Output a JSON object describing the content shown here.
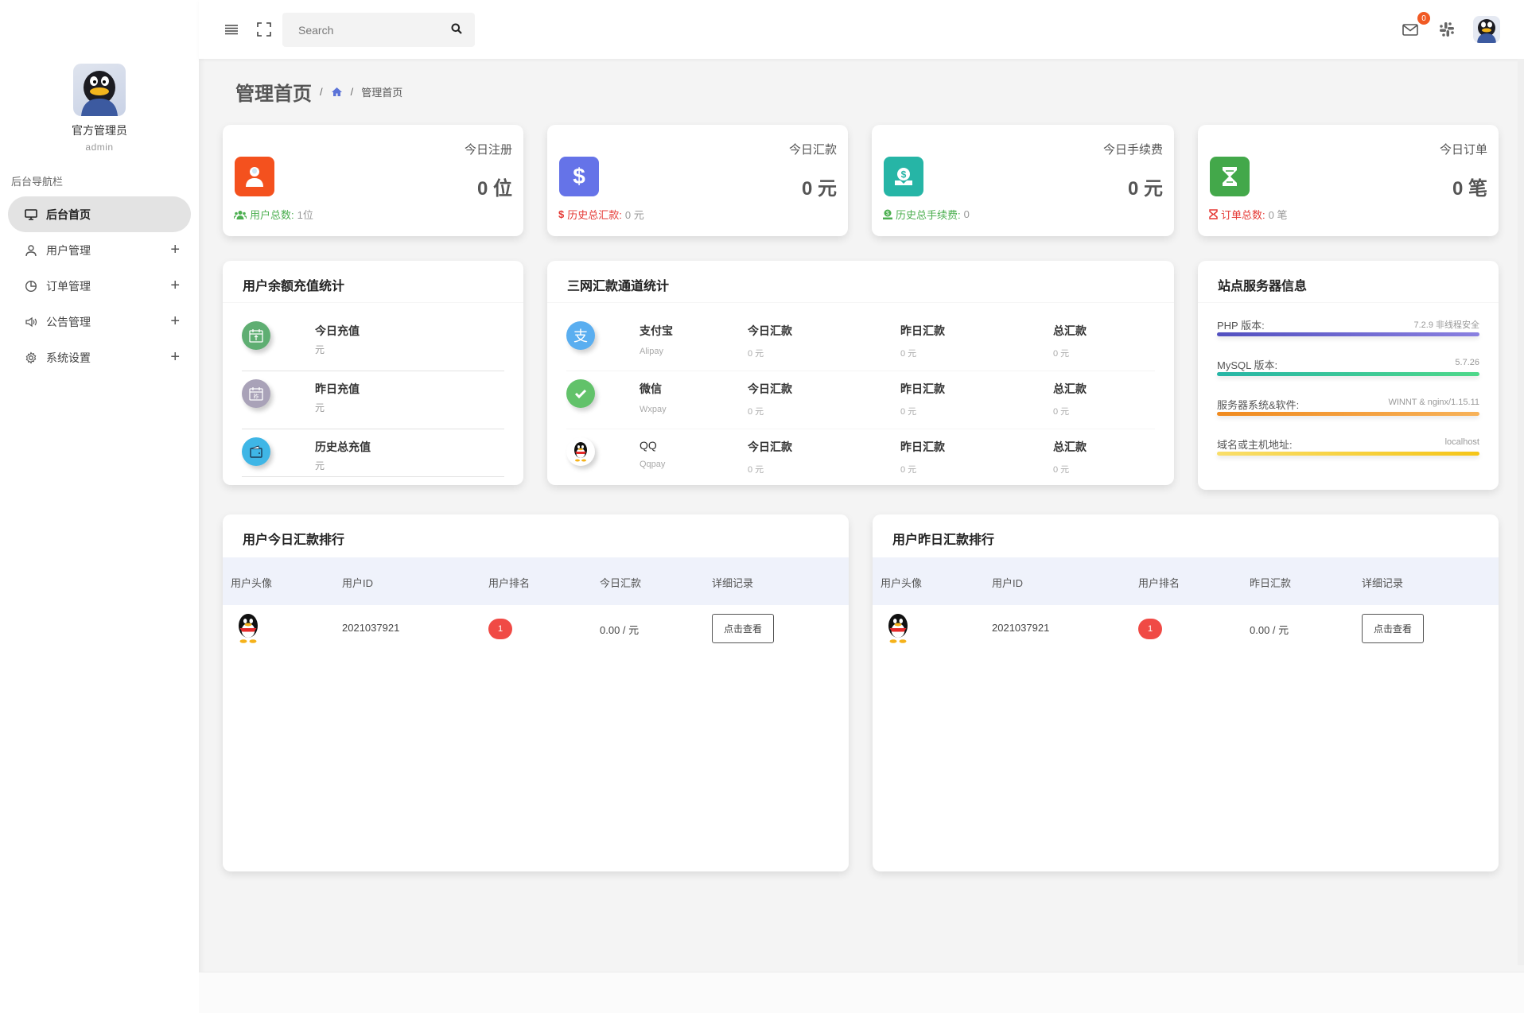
{
  "sidebar": {
    "profile": {
      "name": "官方管理员",
      "role": "admin"
    },
    "nav_title": "后台导航栏",
    "items": [
      {
        "label": "后台首页",
        "icon": "monitor-icon",
        "active": true,
        "expandable": false
      },
      {
        "label": "用户管理",
        "icon": "user-icon",
        "active": false,
        "expandable": true
      },
      {
        "label": "订单管理",
        "icon": "pie-chart-icon",
        "active": false,
        "expandable": true
      },
      {
        "label": "公告管理",
        "icon": "speaker-icon",
        "active": false,
        "expandable": true
      },
      {
        "label": "系统设置",
        "icon": "gear-icon",
        "active": false,
        "expandable": true
      }
    ],
    "expand_glyph": "+"
  },
  "topbar": {
    "search_placeholder": "Search",
    "mail_badge": "0"
  },
  "page": {
    "title": "管理首页",
    "breadcrumb": {
      "separator": "/",
      "current": "管理首页"
    }
  },
  "stats": [
    {
      "label": "今日注册",
      "value": "0 位",
      "foot_label": "用户总数:",
      "foot_value": "1位",
      "color": "#f4511e",
      "foot_color": "#4caf50",
      "icon": "user-icon"
    },
    {
      "label": "今日汇款",
      "value": "0 元",
      "foot_label": "历史总汇款:",
      "foot_value": "0 元",
      "color": "#6573e8",
      "foot_color": "#e53935",
      "icon": "dollar-icon"
    },
    {
      "label": "今日手续费",
      "value": "0 元",
      "foot_label": "历史总手续费:",
      "foot_value": "0",
      "color": "#26b5a6",
      "foot_color": "#4caf50",
      "icon": "money-bag-icon"
    },
    {
      "label": "今日订单",
      "value": "0 笔",
      "foot_label": "订单总数:",
      "foot_value": "0 笔",
      "color": "#43a84a",
      "foot_color": "#e53935",
      "icon": "hourglass-icon"
    }
  ],
  "recharge": {
    "title": "用户余额充值统计",
    "rows": [
      {
        "name": "今日充值",
        "value": "元",
        "color": "#5fae72"
      },
      {
        "name": "昨日充值",
        "value": "元",
        "color": "#a9a2b8"
      },
      {
        "name": "历史总充值",
        "value": "元",
        "color": "#3fb6e6"
      }
    ]
  },
  "channels": {
    "title": "三网汇款通道统计",
    "rows": [
      {
        "name": "支付宝",
        "code": "Alipay",
        "today_label": "今日汇款",
        "today": "0 元",
        "yesterday_label": "昨日汇款",
        "yesterday": "0 元",
        "total_label": "总汇款",
        "total": "0 元"
      },
      {
        "name": "微信",
        "code": "Wxpay",
        "today_label": "今日汇款",
        "today": "0 元",
        "yesterday_label": "昨日汇款",
        "yesterday": "0 元",
        "total_label": "总汇款",
        "total": "0 元"
      },
      {
        "name": "QQ",
        "code": "Qqpay",
        "today_label": "今日汇款",
        "today": "0 元",
        "yesterday_label": "昨日汇款",
        "yesterday": "0 元",
        "total_label": "总汇款",
        "total": "0 元"
      }
    ]
  },
  "server": {
    "title": "站点服务器信息",
    "rows": [
      {
        "key": "PHP 版本:",
        "value": "7.2.9 非线程安全",
        "colors": [
          "#5250c0",
          "#8a80e0"
        ]
      },
      {
        "key": "MySQL 版本:",
        "value": "5.7.26",
        "colors": [
          "#26b5a6",
          "#4fd88a"
        ]
      },
      {
        "key": "服务器系统&软件:",
        "value": "WINNT & nginx/1.15.11",
        "colors": [
          "#f08a1e",
          "#f7b259"
        ]
      },
      {
        "key": "域名或主机地址:",
        "value": "localhost",
        "colors": [
          "#f9de6a",
          "#f5c518"
        ]
      }
    ]
  },
  "rank_today": {
    "title": "用户今日汇款排行",
    "headers": [
      "用户头像",
      "用户ID",
      "用户排名",
      "今日汇款",
      "详细记录"
    ],
    "rows": [
      {
        "user_id": "2021037921",
        "rank": "1",
        "amount": "0.00 / 元",
        "action": "点击查看"
      }
    ]
  },
  "rank_yesterday": {
    "title": "用户昨日汇款排行",
    "headers": [
      "用户头像",
      "用户ID",
      "用户排名",
      "昨日汇款",
      "详细记录"
    ],
    "rows": [
      {
        "user_id": "2021037921",
        "rank": "1",
        "amount": "0.00 / 元",
        "action": "点击查看"
      }
    ]
  }
}
